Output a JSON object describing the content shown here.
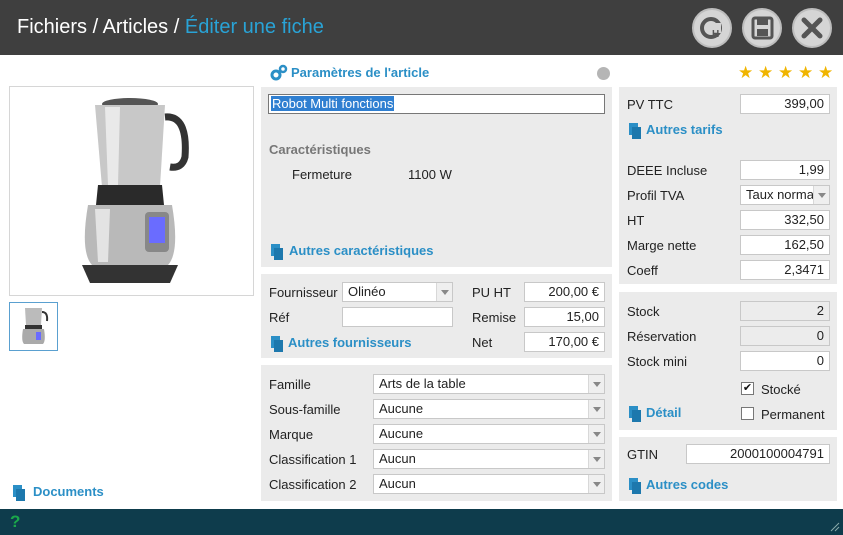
{
  "breadcrumb": {
    "part1": "Fichiers",
    "sep1": "/",
    "part2": "Articles",
    "sep2": "/",
    "current": "Éditer une fiche"
  },
  "toolbar": {
    "history_icon": "history-icon",
    "save_icon": "save-icon",
    "close_icon": "close-icon"
  },
  "product": {
    "name": "Robot Multi fonctions",
    "rating": 5
  },
  "params": {
    "title": "Paramètres de l'article",
    "characteristics_title": "Caractéristiques",
    "char_label": "Fermeture",
    "char_value": "1100 W",
    "more_characteristics": "Autres caractéristiques"
  },
  "supplier": {
    "label": "Fournisseur",
    "value": "Olinéo",
    "ref_label": "Réf",
    "ref_value": "",
    "more": "Autres fournisseurs",
    "puht_label": "PU HT",
    "puht_value": "200,00 €",
    "remise_label": "Remise",
    "remise_value": "15,00",
    "net_label": "Net",
    "net_value": "170,00 €"
  },
  "classification": {
    "famille_label": "Famille",
    "famille_value": "Arts de la table",
    "sousfamille_label": "Sous-famille",
    "sousfamille_value": "Aucune",
    "marque_label": "Marque",
    "marque_value": "Aucune",
    "class1_label": "Classification 1",
    "class1_value": "Aucun",
    "class2_label": "Classification 2",
    "class2_value": "Aucun"
  },
  "pricing": {
    "pvttc_label": "PV TTC",
    "pvttc_value": "399,00",
    "more_tarifs": "Autres tarifs",
    "deee_label": "DEEE Incluse",
    "deee_value": "1,99",
    "tva_label": "Profil TVA",
    "tva_value": "Taux normal",
    "ht_label": "HT",
    "ht_value": "332,50",
    "marge_label": "Marge nette",
    "marge_value": "162,50",
    "coeff_label": "Coeff",
    "coeff_value": "2,3471"
  },
  "stock": {
    "stock_label": "Stock",
    "stock_value": "2",
    "reservation_label": "Réservation",
    "reservation_value": "0",
    "mini_label": "Stock mini",
    "mini_value": "0",
    "stocke_label": "Stocké",
    "stocke_checked": true,
    "permanent_label": "Permanent",
    "permanent_checked": false,
    "detail": "Détail"
  },
  "gtin": {
    "label": "GTIN",
    "value": "2000100004791",
    "more_codes": "Autres codes"
  },
  "left": {
    "documents": "Documents"
  },
  "footer": {
    "help": "?"
  }
}
